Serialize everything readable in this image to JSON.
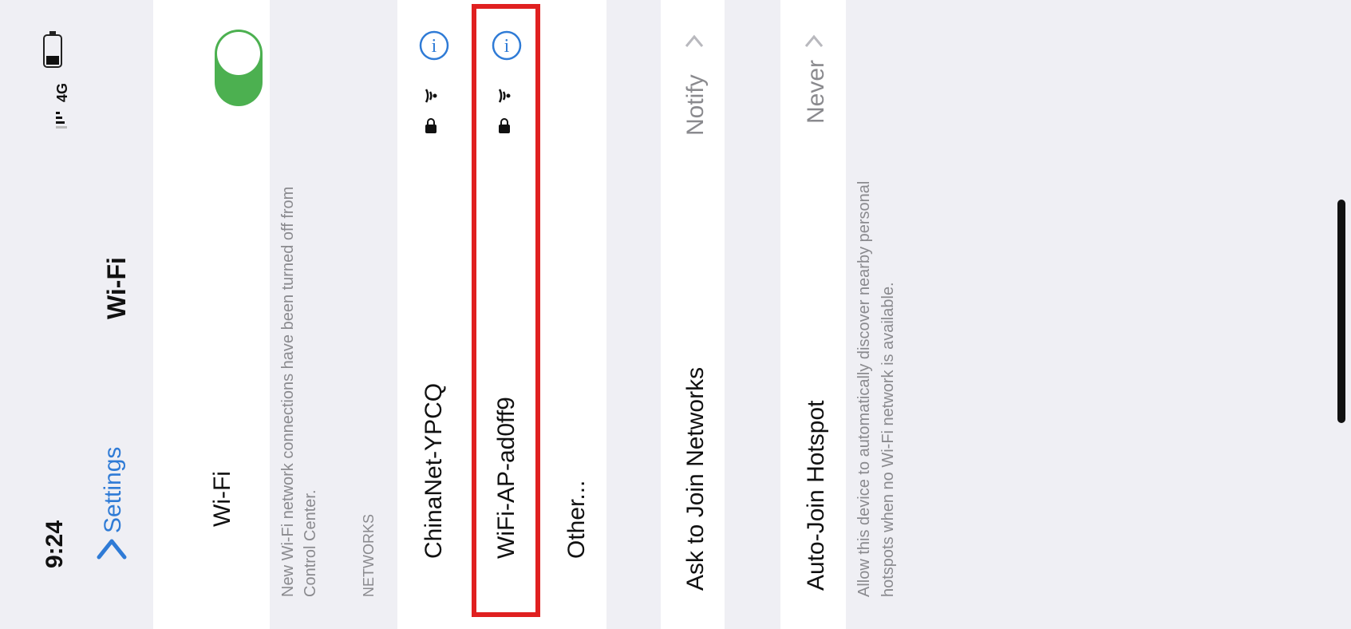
{
  "status_bar": {
    "time": "9:24",
    "network": "4G"
  },
  "nav": {
    "back_label": "Settings",
    "title": "Wi-Fi"
  },
  "wifi_toggle": {
    "label": "Wi-Fi",
    "enabled": true
  },
  "notice": {
    "line1": "New Wi-Fi network connections have been turned off from",
    "line2": "Control Center."
  },
  "networks": {
    "header": "NETWORKS",
    "items": [
      {
        "name": "ChinaNet-YPCQ",
        "secured": true,
        "highlighted": false
      },
      {
        "name": "WiFi-AP-ad0ff9",
        "secured": true,
        "highlighted": true
      }
    ],
    "other_label": "Other..."
  },
  "ask_to_join": {
    "label": "Ask to Join Networks",
    "value": "Notify"
  },
  "auto_join": {
    "label": "Auto-Join Hotspot",
    "value": "Never",
    "footer_line1": "Allow this device to automatically discover nearby personal",
    "footer_line2": "hotspots when no Wi-Fi network is available."
  },
  "colors": {
    "accent": "#2f7bd6",
    "toggle_on": "#4cb050",
    "highlight": "#e02020",
    "group_bg": "#efeff4"
  }
}
